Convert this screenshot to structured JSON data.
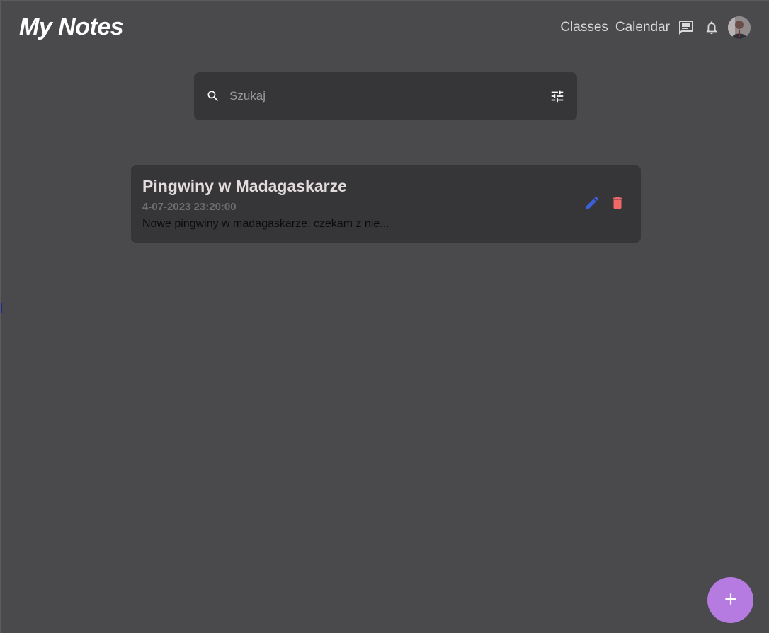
{
  "header": {
    "title": "My Notes",
    "nav_links": [
      "Classes",
      "Calendar"
    ],
    "icons": [
      "chat-icon",
      "bell-icon"
    ],
    "avatar": "user-avatar"
  },
  "search": {
    "placeholder": "Szukaj",
    "value": "",
    "icons": {
      "left": "search-icon",
      "right": "filter-icon"
    }
  },
  "notes": [
    {
      "title": "Pingwiny w Madagaskarze",
      "date": "4-07-2023 23:20:00",
      "preview": "Nowe pingwiny w madagaskarze, czekam z nie...",
      "actions": [
        "edit-icon",
        "delete-icon"
      ]
    }
  ],
  "fab": {
    "icon": "plus-icon"
  },
  "colors": {
    "background": "#4a4a4c",
    "surface": "#363638",
    "accent": "#b57be0",
    "edit": "#3b5fd6",
    "delete": "#f06868"
  }
}
